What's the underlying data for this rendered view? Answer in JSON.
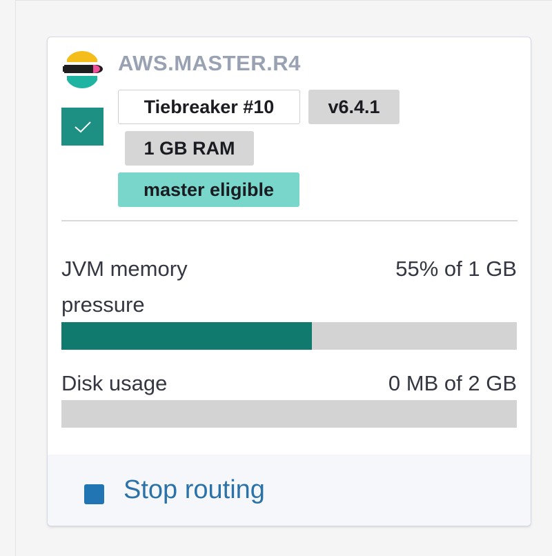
{
  "node": {
    "name": "AWS.MASTER.R4",
    "selected": true
  },
  "badges": {
    "tiebreaker": "Tiebreaker #10",
    "version": "v6.4.1",
    "ram": "1 GB RAM",
    "role": "master eligible"
  },
  "metrics": {
    "jvm": {
      "label_line1": "JVM memory",
      "label_line2": "pressure",
      "value": "55% of 1 GB",
      "percent": 55
    },
    "disk": {
      "label": "Disk usage",
      "value": "0 MB of 2 GB",
      "percent": 0
    }
  },
  "footer": {
    "stop_label": "Stop routing"
  },
  "colors": {
    "accent_teal": "#117a6e",
    "checkbox": "#1e8f83",
    "role_badge": "#79d6cb",
    "link_blue": "#2b72a8"
  },
  "icons": {
    "logo": "elastic-logo-icon",
    "check": "check-icon",
    "stop": "stop-icon"
  }
}
